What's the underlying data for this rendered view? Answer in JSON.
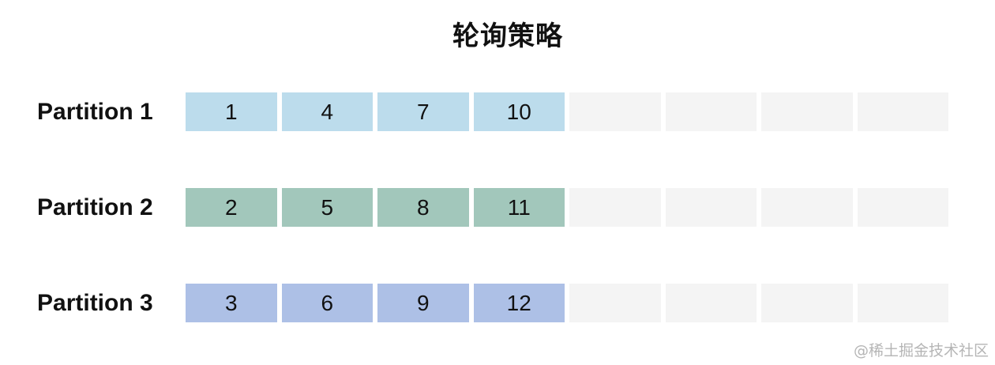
{
  "title": "轮询策略",
  "partitions": [
    {
      "label": "Partition 1",
      "color": "#bcdcec",
      "messages": [
        "1",
        "4",
        "7",
        "10"
      ],
      "empty_slots": 4
    },
    {
      "label": "Partition 2",
      "color": "#a2c7bb",
      "messages": [
        "2",
        "5",
        "8",
        "11"
      ],
      "empty_slots": 4
    },
    {
      "label": "Partition 3",
      "color": "#adc0e6",
      "messages": [
        "3",
        "6",
        "9",
        "12"
      ],
      "empty_slots": 4
    }
  ],
  "empty_slot_color": "#f4f4f4",
  "watermark": "@稀土掘金技术社区"
}
